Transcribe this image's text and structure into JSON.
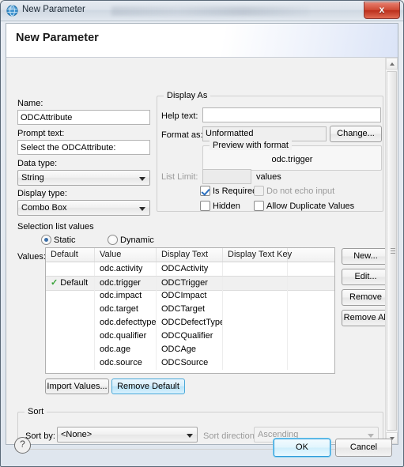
{
  "window": {
    "title": "New Parameter",
    "icon": "globe-icon",
    "close_label": "x"
  },
  "header": {
    "title": "New Parameter"
  },
  "left_form": {
    "name_label": "Name:",
    "name_value": "ODCAttribute",
    "prompt_label": "Prompt text:",
    "prompt_value": "Select the ODCAttribute:",
    "data_type_label": "Data type:",
    "data_type_value": "String",
    "display_type_label": "Display type:",
    "display_type_value": "Combo Box"
  },
  "display_as": {
    "group_title": "Display As",
    "help_text_label": "Help text:",
    "help_text_value": "",
    "format_as_label": "Format as:",
    "format_as_value": "Unformatted",
    "change_button": "Change...",
    "preview_group_title": "Preview with format",
    "preview_value": "odc.trigger",
    "list_limit_label": "List Limit:",
    "list_limit_value": "",
    "list_limit_suffix": "values",
    "checkboxes": [
      {
        "label": "Is Required",
        "checked": true,
        "disabled": false
      },
      {
        "label": "Do not echo input",
        "checked": false,
        "disabled": true
      },
      {
        "label": "Hidden",
        "checked": false,
        "disabled": false
      },
      {
        "label": "Allow Duplicate Values",
        "checked": false,
        "disabled": false
      }
    ]
  },
  "selection_list": {
    "section_label": "Selection list values",
    "radio_static": "Static",
    "radio_dynamic": "Dynamic",
    "static_selected": true,
    "values_label": "Values:",
    "columns": [
      "Default",
      "Value",
      "Display Text",
      "Display Text Key",
      ""
    ],
    "rows": [
      {
        "default": "",
        "check": false,
        "value": "odc.activity",
        "display_text": "ODCActivity",
        "display_text_key": "",
        "extra": "",
        "selected": false
      },
      {
        "default": "Default",
        "check": true,
        "value": "odc.trigger",
        "display_text": "ODCTrigger",
        "display_text_key": "",
        "extra": "",
        "selected": true
      },
      {
        "default": "",
        "check": false,
        "value": "odc.impact",
        "display_text": "ODCImpact",
        "display_text_key": "",
        "extra": "",
        "selected": false
      },
      {
        "default": "",
        "check": false,
        "value": "odc.target",
        "display_text": "ODCTarget",
        "display_text_key": "",
        "extra": "",
        "selected": false
      },
      {
        "default": "",
        "check": false,
        "value": "odc.defecttype",
        "display_text": "ODCDefectType",
        "display_text_key": "",
        "extra": "",
        "selected": false
      },
      {
        "default": "",
        "check": false,
        "value": "odc.qualifier",
        "display_text": "ODCQualifier",
        "display_text_key": "",
        "extra": "",
        "selected": false
      },
      {
        "default": "",
        "check": false,
        "value": "odc.age",
        "display_text": "ODCAge",
        "display_text_key": "",
        "extra": "",
        "selected": false
      },
      {
        "default": "",
        "check": false,
        "value": "odc.source",
        "display_text": "ODCSource",
        "display_text_key": "",
        "extra": "",
        "selected": false
      }
    ],
    "side_buttons": [
      "New...",
      "Edit...",
      "Remove",
      "Remove All"
    ],
    "bottom_buttons": [
      "Import Values...",
      "Remove Default"
    ]
  },
  "sort": {
    "group_title": "Sort",
    "sort_by_label": "Sort by:",
    "sort_by_value": "<None>",
    "sort_direction_label": "Sort direction:",
    "sort_direction_value": "Ascending",
    "sort_direction_disabled": true
  },
  "footer": {
    "help_icon": "question-mark-icon",
    "ok_label": "OK",
    "cancel_label": "Cancel"
  }
}
